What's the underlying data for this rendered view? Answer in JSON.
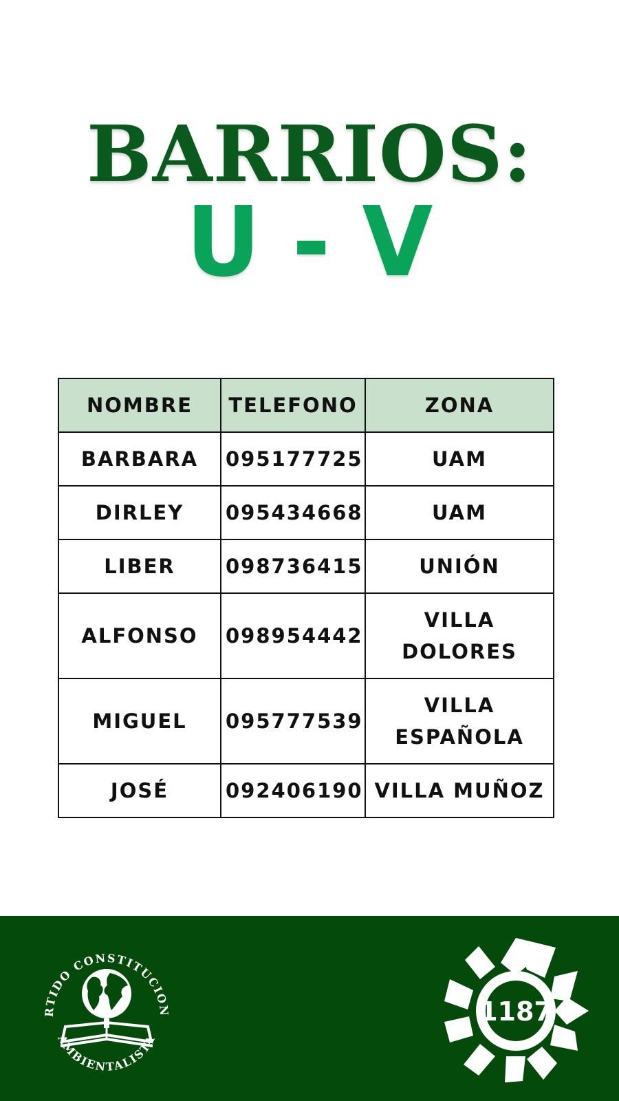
{
  "title": {
    "main": "BARRIOS:",
    "sub": "U - V"
  },
  "table": {
    "headers": [
      "NOMBRE",
      "TELEFONO",
      "ZONA"
    ],
    "rows": [
      {
        "nombre": "BARBARA",
        "telefono": "095177725",
        "zona": "UAM"
      },
      {
        "nombre": "DIRLEY",
        "telefono": "095434668",
        "zona": "UAM"
      },
      {
        "nombre": "LIBER",
        "telefono": "098736415",
        "zona": "UNIÓN"
      },
      {
        "nombre": "ALFONSO",
        "telefono": "098954442",
        "zona": "VILLA DOLORES"
      },
      {
        "nombre": "MIGUEL",
        "telefono": "095777539",
        "zona": "VILLA ESPAÑOLA"
      },
      {
        "nombre": "JOSÉ",
        "telefono": "092406190",
        "zona": "VILLA MUÑOZ"
      }
    ]
  },
  "footer": {
    "party_logo": {
      "arc_top": "PARTIDO CONSTITUCIONAL",
      "arc_bottom": "AMBIENTALISTA",
      "icon": "globe-on-book-icon"
    },
    "list_logo": {
      "number": "1187",
      "icon": "pinwheel-star-icon"
    }
  },
  "colors": {
    "title_dark_green": "#0a5a1e",
    "title_light_green": "#0aa35a",
    "header_fill": "#c8e0cc",
    "footer_green": "#044a0b"
  }
}
